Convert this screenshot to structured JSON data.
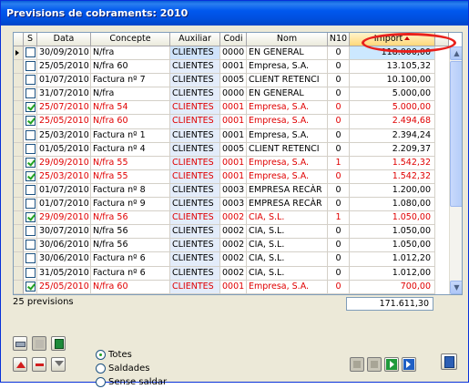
{
  "window": {
    "title": "Previsions de cobraments: 2010"
  },
  "grid": {
    "columns": [
      {
        "label": "",
        "w": 11
      },
      {
        "label": "S",
        "w": 15
      },
      {
        "label": "Data",
        "w": 59
      },
      {
        "label": "Concepte",
        "w": 87
      },
      {
        "label": "Auxiliar",
        "w": 55
      },
      {
        "label": "Codi",
        "w": 29
      },
      {
        "label": "Nom",
        "w": 89
      },
      {
        "label": "N10",
        "w": 24
      },
      {
        "label": "Import",
        "w": 94,
        "sorted": true
      },
      {
        "label": "",
        "w": 15
      }
    ],
    "rows": [
      {
        "checked": false,
        "data": "30/09/2010",
        "concepte": "N/fra",
        "auxiliar": "CLIENTES",
        "codi": "0000",
        "nom": "EN GENERAL",
        "n": "0",
        "import": "118.000,00",
        "red": false
      },
      {
        "checked": false,
        "data": "25/05/2010",
        "concepte": "N/fra 60",
        "auxiliar": "CLIENTES",
        "codi": "0001",
        "nom": "Empresa, S.A.",
        "n": "0",
        "import": "13.105,32",
        "red": false
      },
      {
        "checked": false,
        "data": "01/07/2010",
        "concepte": "Factura nº 7",
        "auxiliar": "CLIENTES",
        "codi": "0005",
        "nom": "CLIENT RETENCI",
        "n": "0",
        "import": "10.100,00",
        "red": false
      },
      {
        "checked": false,
        "data": "31/07/2010",
        "concepte": "N/fra",
        "auxiliar": "CLIENTES",
        "codi": "0000",
        "nom": "EN GENERAL",
        "n": "0",
        "import": "5.000,00",
        "red": false
      },
      {
        "checked": true,
        "data": "25/07/2010",
        "concepte": "N/fra 54",
        "auxiliar": "CLIENTES",
        "codi": "0001",
        "nom": "Empresa, S.A.",
        "n": "0",
        "import": "5.000,00",
        "red": true
      },
      {
        "checked": true,
        "data": "25/05/2010",
        "concepte": "N/fra 60",
        "auxiliar": "CLIENTES",
        "codi": "0001",
        "nom": "Empresa, S.A.",
        "n": "0",
        "import": "2.494,68",
        "red": true
      },
      {
        "checked": false,
        "data": "25/03/2010",
        "concepte": "Factura nº 1",
        "auxiliar": "CLIENTES",
        "codi": "0001",
        "nom": "Empresa, S.A.",
        "n": "0",
        "import": "2.394,24",
        "red": false
      },
      {
        "checked": false,
        "data": "01/05/2010",
        "concepte": "Factura nº 4",
        "auxiliar": "CLIENTES",
        "codi": "0005",
        "nom": "CLIENT RETENCI",
        "n": "0",
        "import": "2.209,37",
        "red": false
      },
      {
        "checked": true,
        "data": "29/09/2010",
        "concepte": "N/fra 55",
        "auxiliar": "CLIENTES",
        "codi": "0001",
        "nom": "Empresa, S.A.",
        "n": "1",
        "import": "1.542,32",
        "red": true
      },
      {
        "checked": true,
        "data": "25/03/2010",
        "concepte": "N/fra 55",
        "auxiliar": "CLIENTES",
        "codi": "0001",
        "nom": "Empresa, S.A.",
        "n": "0",
        "import": "1.542,32",
        "red": true
      },
      {
        "checked": false,
        "data": "01/07/2010",
        "concepte": "Factura nº 8",
        "auxiliar": "CLIENTES",
        "codi": "0003",
        "nom": "EMPRESA RECÀR",
        "n": "0",
        "import": "1.200,00",
        "red": false
      },
      {
        "checked": false,
        "data": "01/07/2010",
        "concepte": "Factura nº 9",
        "auxiliar": "CLIENTES",
        "codi": "0003",
        "nom": "EMPRESA RECÀR",
        "n": "0",
        "import": "1.080,00",
        "red": false
      },
      {
        "checked": true,
        "data": "29/09/2010",
        "concepte": "N/fra 56",
        "auxiliar": "CLIENTES",
        "codi": "0002",
        "nom": "CIA, S.L.",
        "n": "1",
        "import": "1.050,00",
        "red": true
      },
      {
        "checked": false,
        "data": "30/07/2010",
        "concepte": "N/fra 56",
        "auxiliar": "CLIENTES",
        "codi": "0002",
        "nom": "CIA, S.L.",
        "n": "0",
        "import": "1.050,00",
        "red": false
      },
      {
        "checked": false,
        "data": "30/06/2010",
        "concepte": "N/fra 56",
        "auxiliar": "CLIENTES",
        "codi": "0002",
        "nom": "CIA, S.L.",
        "n": "0",
        "import": "1.050,00",
        "red": false
      },
      {
        "checked": false,
        "data": "30/06/2010",
        "concepte": "Factura nº 6",
        "auxiliar": "CLIENTES",
        "codi": "0002",
        "nom": "CIA, S.L.",
        "n": "0",
        "import": "1.012,20",
        "red": false
      },
      {
        "checked": false,
        "data": "31/05/2010",
        "concepte": "Factura nº 6",
        "auxiliar": "CLIENTES",
        "codi": "0002",
        "nom": "CIA, S.L.",
        "n": "0",
        "import": "1.012,00",
        "red": false
      },
      {
        "checked": true,
        "data": "25/05/2010",
        "concepte": "N/fra 60",
        "auxiliar": "CLIENTES",
        "codi": "0001",
        "nom": "Empresa, S.A.",
        "n": "0",
        "import": "700,00",
        "red": true
      }
    ]
  },
  "footer": {
    "count": "25 previsions",
    "total": "171.611,30"
  },
  "filter": {
    "options": [
      "Totes",
      "Saldades",
      "Sense saldar"
    ],
    "selected": "Totes"
  },
  "icons": {
    "left_top": [
      "print-icon",
      "blank-icon",
      "book-icon"
    ],
    "left_bottom": [
      "triangle-up-icon",
      "minus-icon",
      "funnel-icon"
    ],
    "nav": [
      "first-icon",
      "prev-icon",
      "play-icon",
      "last-icon"
    ],
    "exit": "exit-icon"
  },
  "colors": {
    "red": "#e00000",
    "green": "#21a121",
    "titlebar": "#0058ee"
  }
}
